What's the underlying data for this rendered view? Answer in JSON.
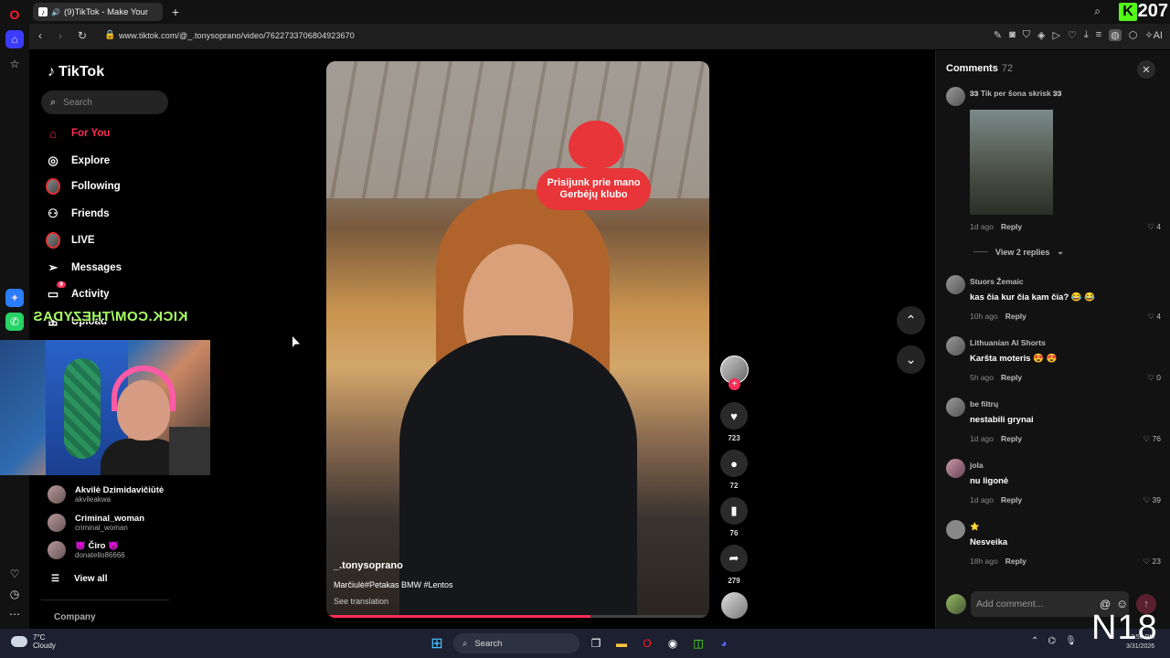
{
  "browser": {
    "tab_title": "(9)TikTok - Make Your",
    "url": "www.tiktok.com/@_.tonysoprano/video/7622733706804923670",
    "ai_label": "AI"
  },
  "stream": {
    "viewer_count": "207",
    "overlay_text": "KICK.COM/THEZYDAS",
    "corner_logo": "N18"
  },
  "tiktok": {
    "logo": "TikTok",
    "search_placeholder": "Search",
    "nav": {
      "for_you": "For You",
      "explore": "Explore",
      "following": "Following",
      "friends": "Friends",
      "live": "LIVE",
      "messages": "Messages",
      "activity": "Activity",
      "activity_badge": "9",
      "upload": "Upload"
    },
    "following_accounts": [
      {
        "name": "Akvilė Dzimidavičiūtė",
        "handle": "akvileakwa"
      },
      {
        "name": "Criminal_woman",
        "handle": "criminal_woman"
      },
      {
        "name": "😈 Čiro 😈",
        "handle": "donatello86666"
      }
    ],
    "view_all": "View all",
    "company": "Company"
  },
  "video": {
    "sticker_text_line1": "Prisijunk prie mano",
    "sticker_text_line2": "Gerbėjų klubo",
    "author": "_.tonysoprano",
    "caption": "Marčiulė#Petakas BMW #Lentos",
    "see_translation": "See translation",
    "progress": 0.69,
    "likes": "723",
    "comments": "72",
    "saves": "76",
    "shares": "279"
  },
  "comments_panel": {
    "title": "Comments",
    "count": "72",
    "add_placeholder": "Add comment...",
    "view_replies": "View 2 replies",
    "items": [
      {
        "user": "𝟑𝟑 Tik per šona skrisk 𝟑𝟑",
        "text": "",
        "time": "1d ago",
        "reply": "Reply",
        "likes": "4"
      },
      {
        "user": "Stuors Žemaic",
        "text": "kas čia kur čia kam čia? 😂 😂",
        "time": "10h ago",
        "reply": "Reply",
        "likes": "4"
      },
      {
        "user": "Lithuanian AI Shorts",
        "text": "Karšta moteris 😍 😍",
        "time": "5h ago",
        "reply": "Reply",
        "likes": "0"
      },
      {
        "user": "be filtrų",
        "text": "nestabili grynai",
        "time": "1d ago",
        "reply": "Reply",
        "likes": "76"
      },
      {
        "user": "jola",
        "text": "nu ligonė",
        "time": "1d ago",
        "reply": "Reply",
        "likes": "39"
      },
      {
        "user": "⭐",
        "text": "Nesveika",
        "time": "18h ago",
        "reply": "Reply",
        "likes": "23"
      }
    ]
  },
  "taskbar": {
    "temp": "7°C",
    "weather": "Cloudy",
    "search_label": "Search",
    "time": "2:50 PM",
    "date": "3/31/2026"
  },
  "colors": {
    "accent": "#fe2c55",
    "kick_green": "#53fc18"
  }
}
